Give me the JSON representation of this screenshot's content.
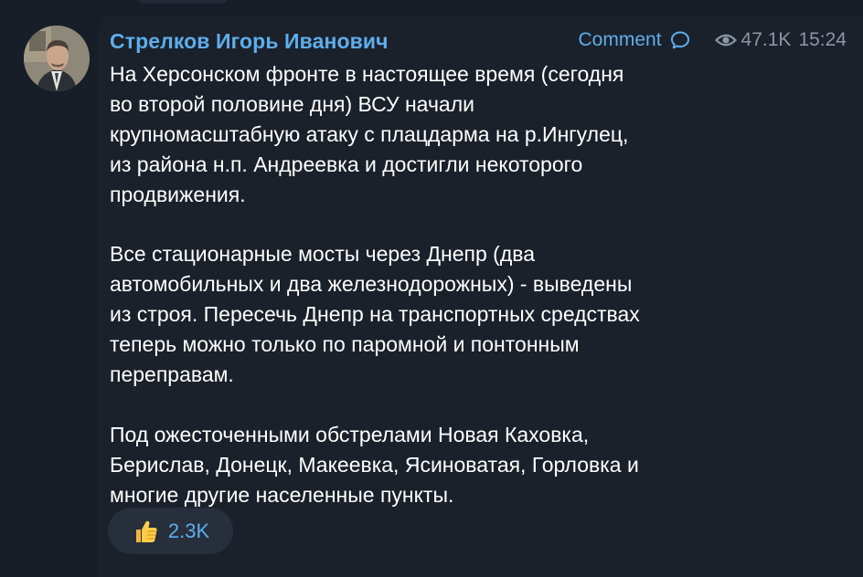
{
  "channel": {
    "author_name": "Стрелков Игорь Иванович",
    "avatar_icon": "profile-photo"
  },
  "meta": {
    "comment_label": "Comment",
    "comment_icon": "comment-bubble-icon",
    "views_icon": "eye-icon",
    "views": "47.1K",
    "time": "15:24"
  },
  "message": {
    "paragraphs": [
      "На Херсонском фронте в настоящее время (сегодня\nво второй половине дня) ВСУ начали\nкрупномасштабную атаку с плацдарма на р.Ингулец,\nиз района н.п. Андреевка и достигли некоторого\nпродвижения.",
      "Все стационарные мосты через Днепр (два\nавтомобильных и два железнодорожных) - выведены\nиз строя. Пересечь Днепр на транспортных средствах\nтеперь можно только по паромной и понтонным\nпереправам.",
      "Под ожесточенными обстрелами Новая Каховка,\nБерислав, Донецк, Макеевка, Ясиноватая, Горловка и\nмногие другие населенные пункты."
    ]
  },
  "reactions": [
    {
      "emoji": "thumbs-up-icon",
      "count": "2.3K"
    }
  ],
  "colors": {
    "background": "#181e28",
    "bubble": "#1b212b",
    "accent": "#5eaeec",
    "muted": "#8b95a3",
    "text": "#ffffff"
  }
}
